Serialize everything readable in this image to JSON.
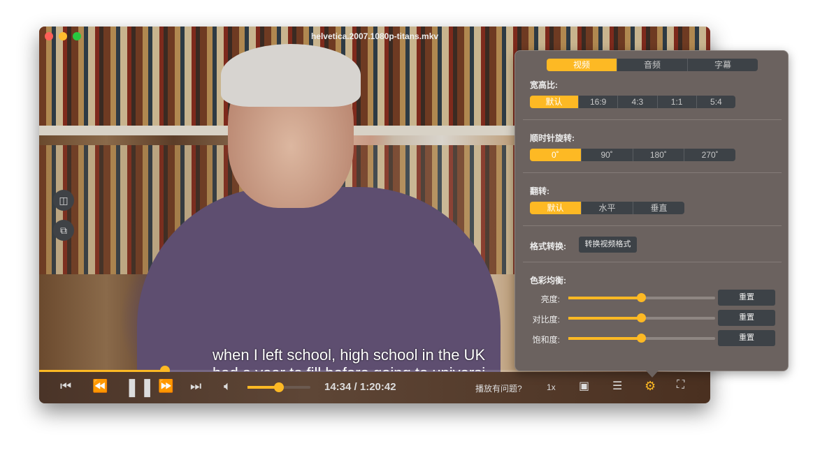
{
  "window": {
    "title": "helvetica.2007.1080p-titans.mkv"
  },
  "subtitle": {
    "line1": "when I left school, high school in the UK",
    "line2": "had a year to fill before going to universi"
  },
  "player": {
    "progress_percent": 18.6,
    "volume_percent": 50,
    "time": "14:34 / 1:20:42",
    "help": "播放有问题?",
    "speed": "1x"
  },
  "panel": {
    "tabs": [
      "视频",
      "音频",
      "字幕"
    ],
    "active_tab": 0,
    "aspect": {
      "label": "宽高比:",
      "options": [
        "默认",
        "16:9",
        "4:3",
        "1:1",
        "5:4"
      ]
    },
    "rotate": {
      "label": "顺时针旋转:",
      "options": [
        "0˚",
        "90˚",
        "180˚",
        "270˚"
      ]
    },
    "flip": {
      "label": "翻转:",
      "options": [
        "默认",
        "水平",
        "垂直"
      ]
    },
    "convert": {
      "label": "格式转换:",
      "button": "转换视频格式"
    },
    "color": {
      "label": "色彩均衡:",
      "reset": "重置",
      "sliders": [
        {
          "label": "亮度:",
          "value": 50
        },
        {
          "label": "对比度:",
          "value": 50
        },
        {
          "label": "饱和度:",
          "value": 50
        }
      ]
    }
  },
  "colors": {
    "accent": "#fdb924"
  }
}
